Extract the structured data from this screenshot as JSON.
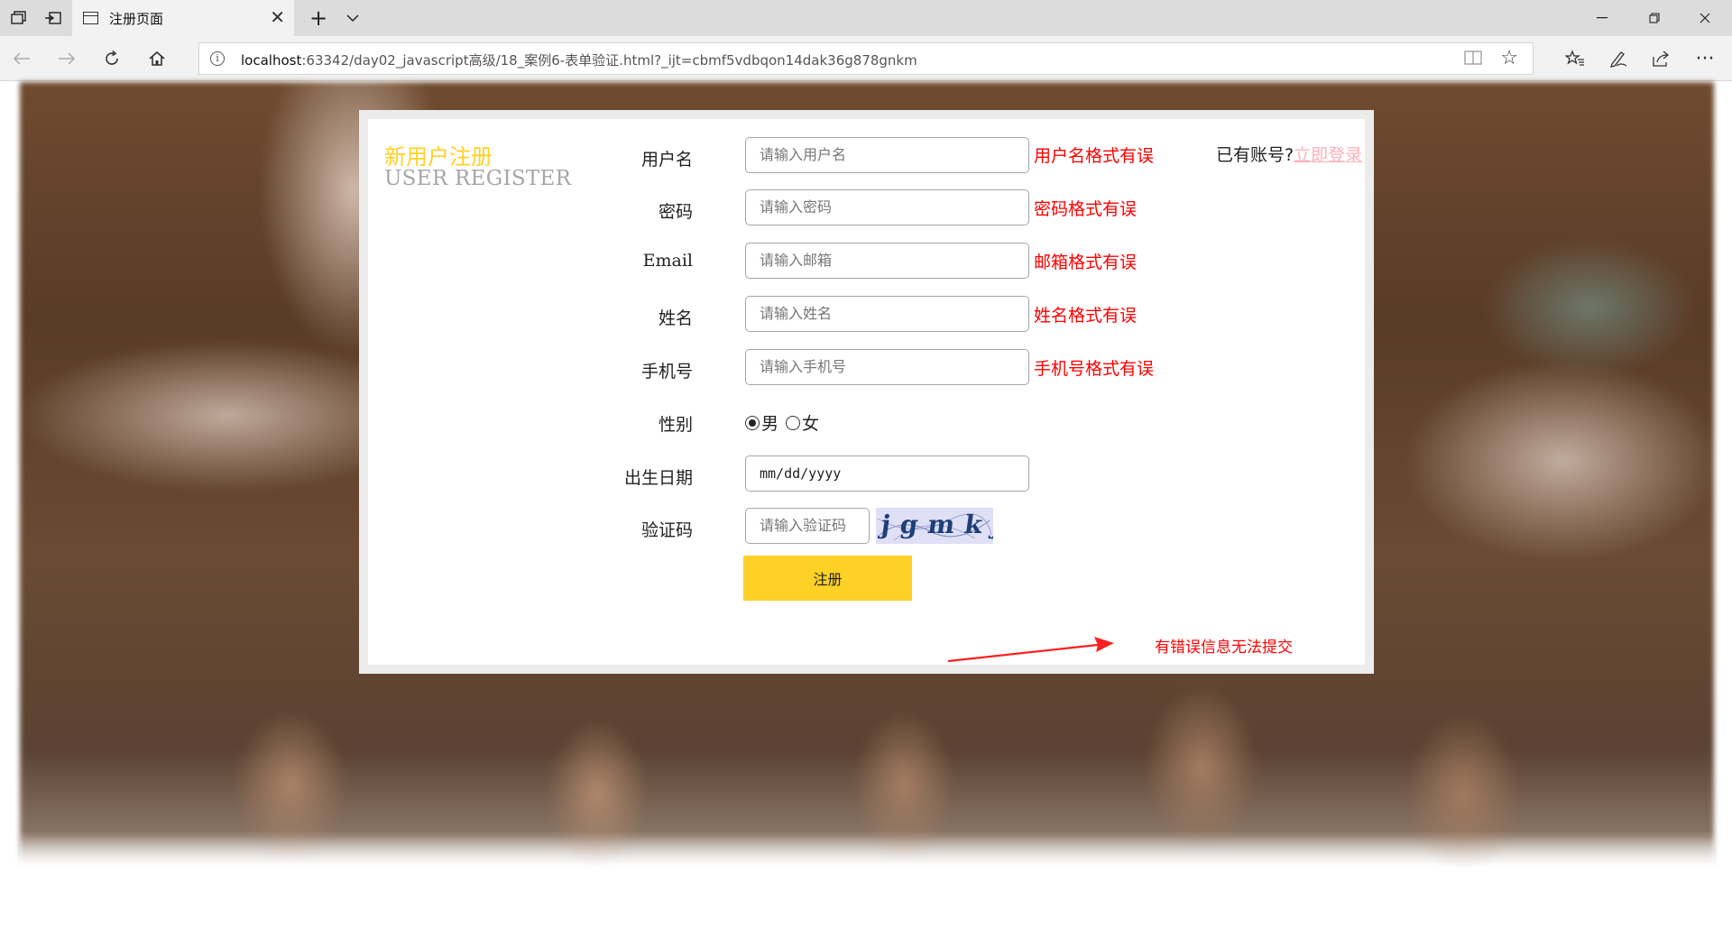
{
  "browser": {
    "tab_title": "注册页面",
    "url_host": "localhost",
    "url_rest": ":63342/day02_javascript高级/18_案例6-表单验证.html?_ijt=cbmf5vdbqon14dak36g878gnkm"
  },
  "page": {
    "title_cn": "新用户注册",
    "title_en": "USER REGISTER",
    "login_prompt": "已有账号?",
    "login_link": "立即登录",
    "fields": {
      "username": {
        "label": "用户名",
        "placeholder": "请输入用户名",
        "error": "用户名格式有误"
      },
      "password": {
        "label": "密码",
        "placeholder": "请输入密码",
        "error": "密码格式有误"
      },
      "email": {
        "label": "Email",
        "placeholder": "请输入邮箱",
        "error": "邮箱格式有误"
      },
      "name": {
        "label": "姓名",
        "placeholder": "请输入姓名",
        "error": "姓名格式有误"
      },
      "phone": {
        "label": "手机号",
        "placeholder": "请输入手机号",
        "error": "手机号格式有误"
      },
      "gender": {
        "label": "性别",
        "male": "男",
        "female": "女",
        "selected": "男"
      },
      "birthday": {
        "label": "出生日期",
        "value": "mm/dd/yyyy"
      },
      "captcha": {
        "label": "验证码",
        "placeholder": "请输入验证码",
        "image_text": "jgmkj"
      }
    },
    "submit_label": "注册",
    "annotation": "有错误信息无法提交"
  },
  "colors": {
    "accent_yellow": "#ffd026",
    "error_red": "#ff0000",
    "link_pink": "#ffb0bd"
  }
}
